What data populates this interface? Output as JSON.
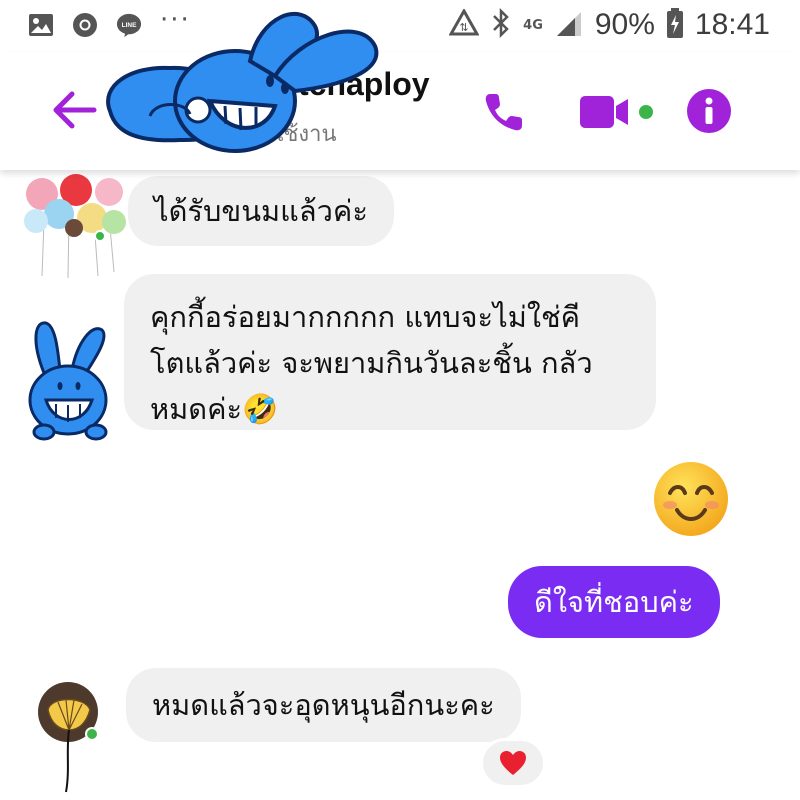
{
  "status_bar": {
    "left_icons": [
      "gallery-icon",
      "chrome-icon",
      "line-icon",
      "more-icon"
    ],
    "line_label": "LINE",
    "network": "4G",
    "battery": "90%",
    "time": "18:41"
  },
  "header": {
    "contact_name": "tchaploy",
    "contact_status": "งใช้งาน",
    "accent_color": "#a123d9"
  },
  "messages": [
    {
      "direction": "in",
      "text": "ได้รับขนมแล้วค่ะ"
    },
    {
      "direction": "in",
      "lines": [
        "คุกกี้อร่อยมากกกกก แทบจะไม่ใช่คี",
        "โตแล้วค่ะ จะพยามกินวันละชิ้น กลัว",
        "หมดค่ะ🤣"
      ]
    },
    {
      "direction": "out",
      "emoji": "😊"
    },
    {
      "direction": "out",
      "text": "ดีใจที่ชอบค่ะ"
    },
    {
      "direction": "in",
      "text": "หมดแล้วจะอุดหนุนอีกนะคะ",
      "reaction": "❤️"
    }
  ],
  "colors": {
    "outgoing_bubble": "#7a2cf3",
    "incoming_bubble": "#f0f0f0",
    "online": "#3bb54a"
  }
}
